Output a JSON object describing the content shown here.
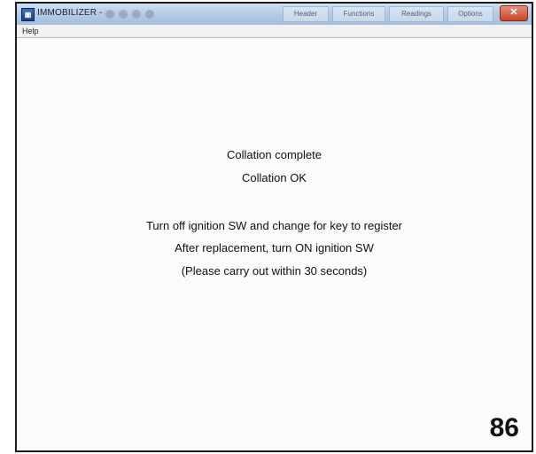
{
  "window": {
    "title": "IMMOBILIZER -",
    "app_icon": "app-icon",
    "close_glyph": "✕",
    "ribbon_tabs": [
      "Header",
      "Functions",
      "Readings",
      "Options"
    ]
  },
  "menu": {
    "help_label": "Help"
  },
  "messages": {
    "line1": "Collation complete",
    "line2": "Collation OK",
    "line3": "Turn off ignition SW and change for key to register",
    "line4": "After replacement, turn ON ignition SW",
    "line5": "(Please carry out within 30 seconds)"
  },
  "page_number": "86"
}
